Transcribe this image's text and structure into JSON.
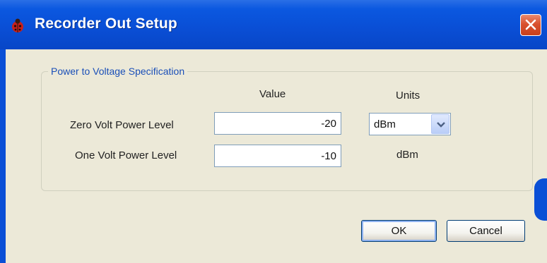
{
  "window": {
    "title": "Recorder Out Setup",
    "icon": "ladybug-icon",
    "close_icon": "close-icon"
  },
  "group": {
    "legend": "Power to Voltage Specification",
    "value_header": "Value",
    "units_header": "Units",
    "rows": [
      {
        "label": "Zero Volt Power Level",
        "value": "-20",
        "units": "dBm"
      },
      {
        "label": "One Volt Power Level",
        "value": "-10",
        "units": "dBm"
      }
    ]
  },
  "buttons": {
    "ok": "OK",
    "cancel": "Cancel"
  },
  "colors": {
    "titlebar": "#0a4fd6",
    "client": "#ece9d8",
    "legend": "#1a4fb8",
    "close": "#d9512e"
  }
}
